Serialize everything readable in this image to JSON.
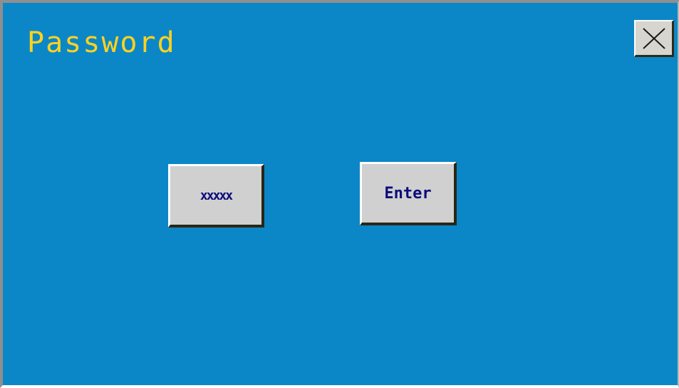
{
  "dialog": {
    "title": "Password",
    "close_icon": "close-x-icon"
  },
  "password_field": {
    "masked_value": "xxxxx"
  },
  "enter_button": {
    "label": "Enter"
  },
  "colors": {
    "background": "#0b87c8",
    "title": "#ffd21f",
    "button_face": "#d0d0d0",
    "button_text": "#0c0c7a"
  }
}
